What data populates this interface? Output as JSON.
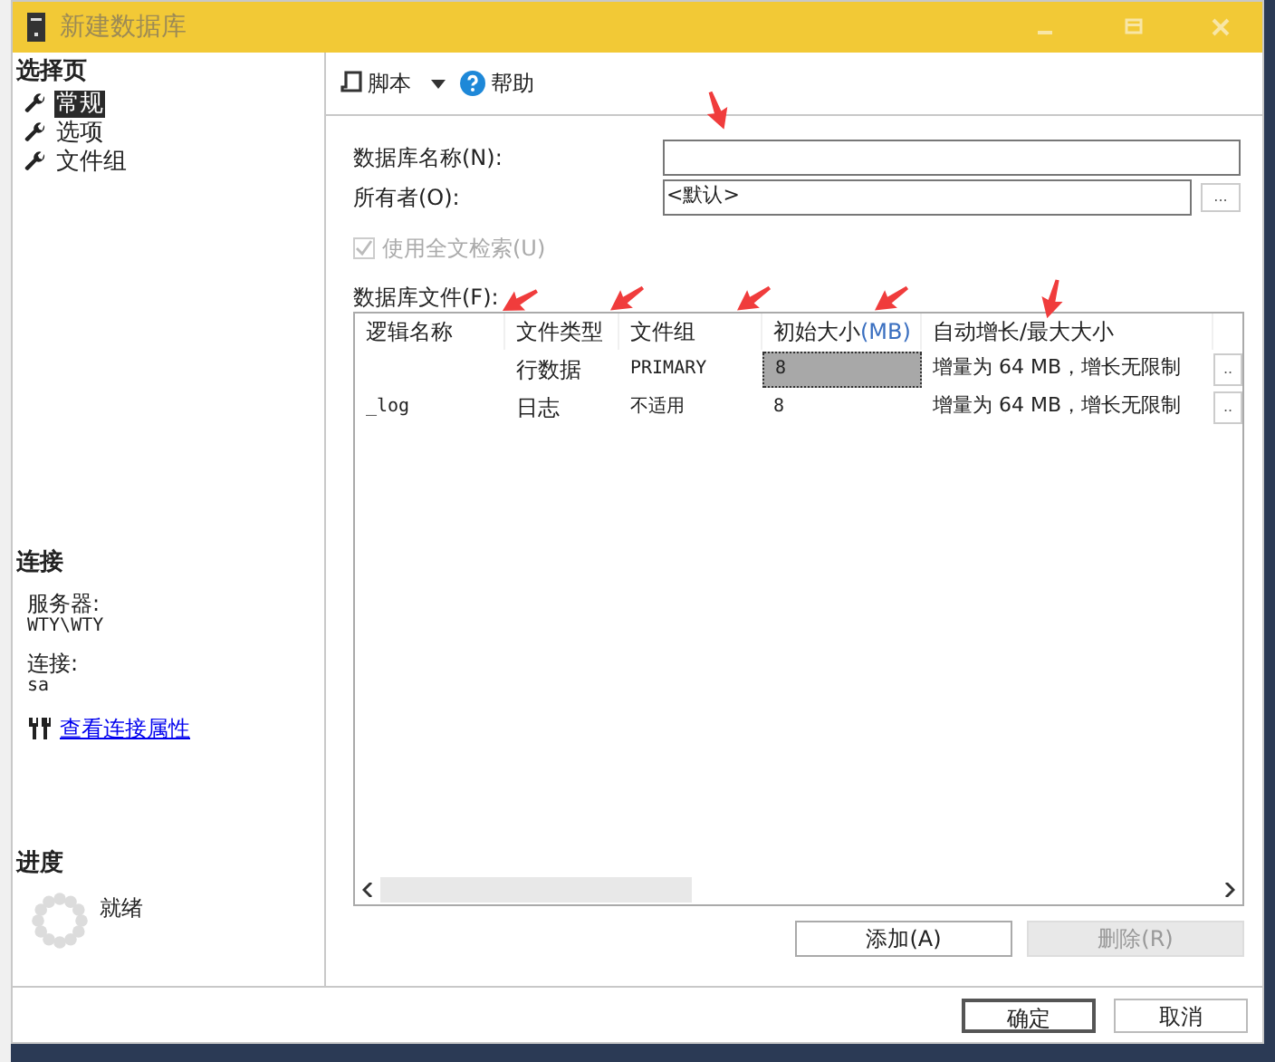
{
  "window": {
    "title": "新建数据库"
  },
  "sidebar": {
    "heading": "选择页",
    "items": [
      {
        "label": "常规",
        "selected": true
      },
      {
        "label": "选项",
        "selected": false
      },
      {
        "label": "文件组",
        "selected": false
      }
    ]
  },
  "connection": {
    "heading": "连接",
    "server_label": "服务器:",
    "server": "WTY\\WTY",
    "login_label": "连接:",
    "login": "sa",
    "link": "查看连接属性"
  },
  "progress": {
    "heading": "进度",
    "status": "就绪"
  },
  "toolbar": {
    "script": "脚本",
    "help": "帮助"
  },
  "form": {
    "name_label": "数据库名称(N):",
    "owner_label": "所有者(O):",
    "owner_value": "<默认>",
    "browse": "...",
    "fulltext": {
      "label": "使用全文检索(U)",
      "checked": true,
      "disabled": true
    }
  },
  "files": {
    "label": "数据库文件(F):",
    "columns": [
      {
        "label": "逻辑名称"
      },
      {
        "label": "文件类型"
      },
      {
        "label": "文件组"
      },
      {
        "label": "初始大小",
        "unit": "(MB)"
      },
      {
        "label": "自动增长/最大大小"
      }
    ],
    "rows": [
      {
        "type": "行数据",
        "filegroup": "PRIMARY",
        "size": "8",
        "growth": "增量为 64 MB，增长无限制",
        "button": "..",
        "selected": true
      },
      {
        "logical_name": "_log",
        "type": "日志",
        "filegroup": "不适用",
        "size": "8",
        "growth": "增量为 64 MB，增长无限制",
        "button": "..",
        "selected": false
      }
    ]
  },
  "actions": [
    {
      "label": "添加(A)",
      "disabled": false
    },
    {
      "label": "删除(R)",
      "disabled": true
    }
  ],
  "buttons": [
    {
      "label": "确定",
      "default": true
    },
    {
      "label": "取消",
      "default": false
    }
  ]
}
